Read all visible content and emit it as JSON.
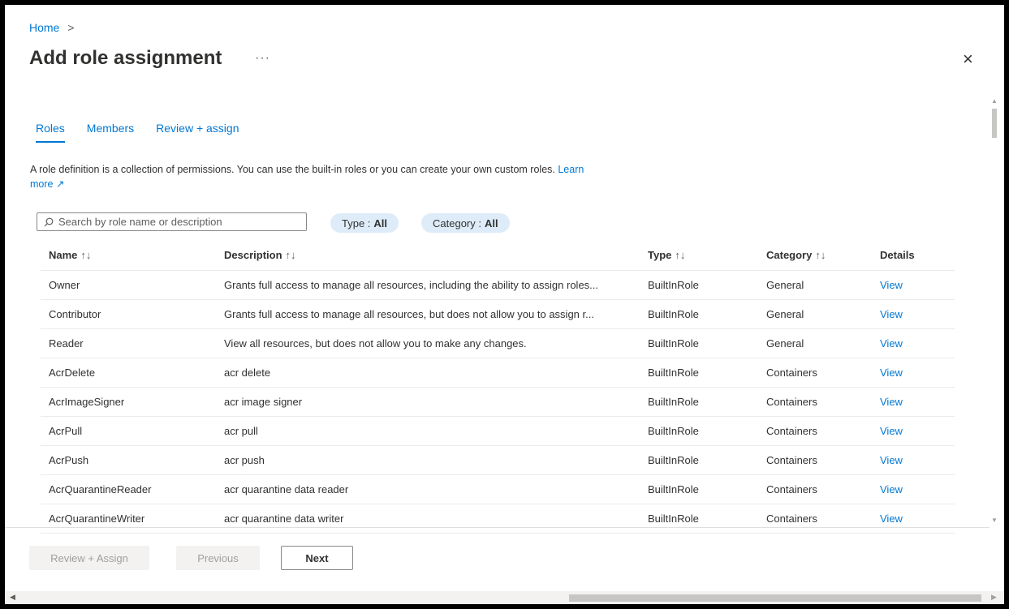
{
  "breadcrumb": {
    "home": "Home",
    "separator": ">"
  },
  "title": "Add role assignment",
  "more_label": "···",
  "close_label": "×",
  "tabs": [
    {
      "label": "Roles",
      "active": true
    },
    {
      "label": "Members",
      "active": false
    },
    {
      "label": "Review + assign",
      "active": false
    }
  ],
  "description": {
    "text": "A role definition is a collection of permissions. You can use the built-in roles or you can create your own custom roles.",
    "link": "Learn more",
    "link_icon": "↗"
  },
  "search": {
    "placeholder": "Search by role name or description"
  },
  "filters": [
    {
      "label": "Type :",
      "value": "All"
    },
    {
      "label": "Category :",
      "value": "All"
    }
  ],
  "table": {
    "columns": [
      "Name",
      "Description",
      "Type",
      "Category",
      "Details"
    ],
    "sort_glyph": "↑↓",
    "rows": [
      {
        "name": "Owner",
        "description": "Grants full access to manage all resources, including the ability to assign roles...",
        "type": "BuiltInRole",
        "category": "General",
        "details": "View"
      },
      {
        "name": "Contributor",
        "description": "Grants full access to manage all resources, but does not allow you to assign r...",
        "type": "BuiltInRole",
        "category": "General",
        "details": "View"
      },
      {
        "name": "Reader",
        "description": "View all resources, but does not allow you to make any changes.",
        "type": "BuiltInRole",
        "category": "General",
        "details": "View"
      },
      {
        "name": "AcrDelete",
        "description": "acr delete",
        "type": "BuiltInRole",
        "category": "Containers",
        "details": "View"
      },
      {
        "name": "AcrImageSigner",
        "description": "acr image signer",
        "type": "BuiltInRole",
        "category": "Containers",
        "details": "View"
      },
      {
        "name": "AcrPull",
        "description": "acr pull",
        "type": "BuiltInRole",
        "category": "Containers",
        "details": "View"
      },
      {
        "name": "AcrPush",
        "description": "acr push",
        "type": "BuiltInRole",
        "category": "Containers",
        "details": "View"
      },
      {
        "name": "AcrQuarantineReader",
        "description": "acr quarantine data reader",
        "type": "BuiltInRole",
        "category": "Containers",
        "details": "View"
      },
      {
        "name": "AcrQuarantineWriter",
        "description": "acr quarantine data writer",
        "type": "BuiltInRole",
        "category": "Containers",
        "details": "View"
      }
    ]
  },
  "buttons": {
    "review_assign": "Review + Assign",
    "previous": "Previous",
    "next": "Next"
  },
  "colors": {
    "accent": "#0078d4",
    "pill_bg": "#deecf9"
  },
  "icons": [
    "search-icon",
    "external-link-icon",
    "close-icon",
    "more-icon"
  ]
}
